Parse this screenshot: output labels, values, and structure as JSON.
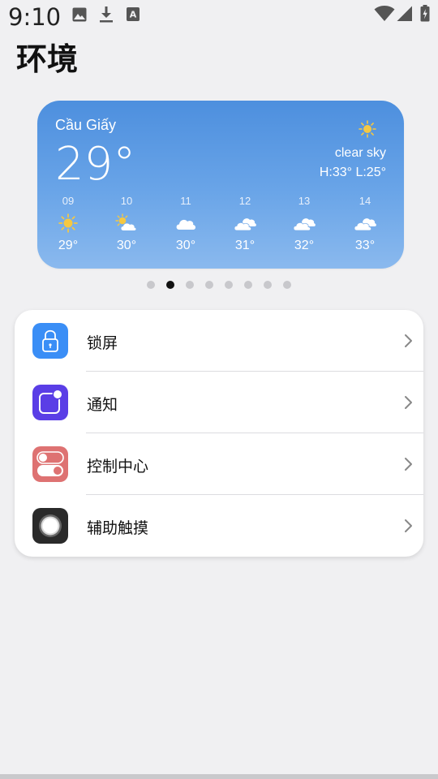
{
  "status_bar": {
    "time": "9:10",
    "icons": [
      "image-icon",
      "download-icon",
      "font-a-icon",
      "wifi-icon",
      "signal-icon",
      "battery-icon"
    ]
  },
  "title": "环境",
  "weather": {
    "city": "Cầu Giấy",
    "temperature": "29°",
    "condition": "clear sky",
    "high_low": "H:33° L:25°",
    "hourly": [
      {
        "time": "09",
        "icon": "sun-icon",
        "temp": "29°"
      },
      {
        "time": "10",
        "icon": "partly-cloudy-icon",
        "temp": "30°"
      },
      {
        "time": "11",
        "icon": "cloud-icon",
        "temp": "30°"
      },
      {
        "time": "12",
        "icon": "clouds-icon",
        "temp": "31°"
      },
      {
        "time": "13",
        "icon": "clouds-icon",
        "temp": "32°"
      },
      {
        "time": "14",
        "icon": "clouds-icon",
        "temp": "33°"
      }
    ]
  },
  "pager": {
    "count": 8,
    "active_index": 1
  },
  "settings": [
    {
      "label": "锁屏",
      "icon": "lock-icon",
      "color": "#3a8ef6"
    },
    {
      "label": "通知",
      "icon": "notification-icon",
      "color": "#5a3ee6"
    },
    {
      "label": "控制中心",
      "icon": "toggle-icon",
      "color": "#de7272"
    },
    {
      "label": "辅助触摸",
      "icon": "assistive-touch-icon",
      "color": "#2a2a2a"
    }
  ]
}
